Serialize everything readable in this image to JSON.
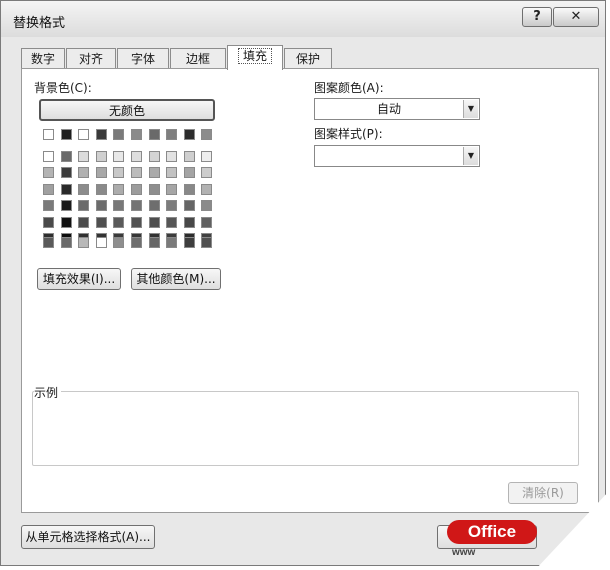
{
  "window": {
    "title": "替换格式",
    "help_label": "?",
    "close_label": "✕"
  },
  "tabs": [
    {
      "label": "数字",
      "active": false
    },
    {
      "label": "对齐",
      "active": false
    },
    {
      "label": "字体",
      "active": false
    },
    {
      "label": "边框",
      "active": false
    },
    {
      "label": "填充",
      "active": true
    },
    {
      "label": "保护",
      "active": false
    }
  ],
  "background": {
    "label": "背景色(C):",
    "no_color_label": "无颜色",
    "fill_effects_label": "填充效果(I)...",
    "more_colors_label": "其他颜色(M)..."
  },
  "pattern": {
    "color_label": "图案颜色(A):",
    "color_value": "自动",
    "style_label": "图案样式(P):",
    "style_value": ""
  },
  "sample": {
    "label": "示例"
  },
  "clear_label": "清除(R)",
  "from_cell_label": "从单元格选择格式(A)...",
  "logo": {
    "text": "Office",
    "sub": "www"
  },
  "palette": {
    "top_row": [
      "#ffffff",
      "#1e1e1e",
      "#ffffff",
      "#3a3a3a",
      "#7a7a7a",
      "#8a8a8a",
      "#6a6a6a",
      "#7f7f7f",
      "#2c2c2c",
      "#8c8c8c"
    ],
    "grid": [
      [
        "#ffffff",
        "#6a6a6a",
        "#dcdcdc",
        "#d0d0d0",
        "#e8e8e8",
        "#dedede",
        "#d4d4d4",
        "#e2e2e2",
        "#cfcfcf",
        "#eeeeee"
      ],
      [
        "#b4b4b4",
        "#3c3c3c",
        "#b0b0b0",
        "#a8a8a8",
        "#c8c8c8",
        "#bcbcbc",
        "#aaaaaa",
        "#c2c2c2",
        "#a4a4a4",
        "#cccccc"
      ],
      [
        "#a0a0a0",
        "#2a2a2a",
        "#8c8c8c",
        "#8a8a8a",
        "#acacac",
        "#9c9c9c",
        "#8e8e8e",
        "#a6a6a6",
        "#888888",
        "#b2b2b2"
      ],
      [
        "#7a7a7a",
        "#1a1a1a",
        "#6a6a6a",
        "#6c6c6c",
        "#787878",
        "#747474",
        "#6e6e6e",
        "#7c7c7c",
        "#666666",
        "#8a8a8a"
      ],
      [
        "#4a4a4a",
        "#101010",
        "#4c4c4c",
        "#505050",
        "#5a5a5a",
        "#525252",
        "#4e4e4e",
        "#565656",
        "#484848",
        "#606060"
      ],
      [
        "#2e2e2e",
        "#0c0c0c",
        "#303030",
        "#333333",
        "#3a3a3a",
        "#363636",
        "#323232",
        "#3c3c3c",
        "#2c2c2c",
        "#404040"
      ]
    ],
    "standard_row": [
      "#5a5a5a",
      "#6a6a6a",
      "#b8b8b8",
      "#ffffff",
      "#8e8e8e",
      "#6e6e6e",
      "#666666",
      "#7a7a7a",
      "#3e3e3e",
      "#505050"
    ]
  }
}
